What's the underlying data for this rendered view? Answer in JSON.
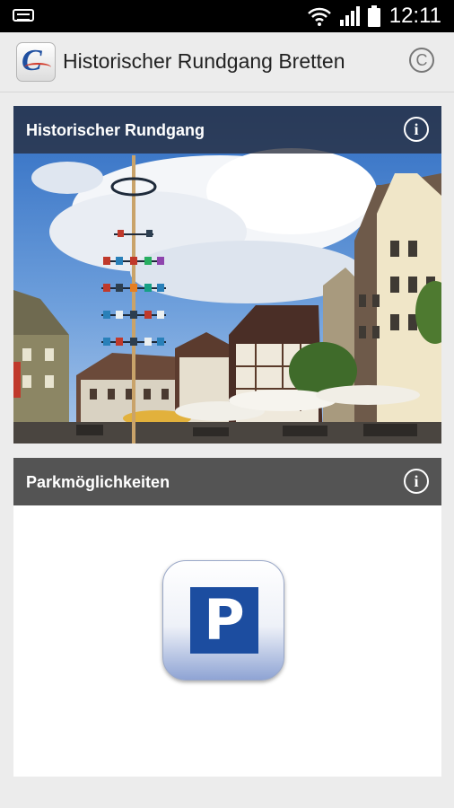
{
  "status_bar": {
    "time": "12:11",
    "icons": [
      "voicemail-icon",
      "wifi-icon",
      "signal-icon",
      "battery-icon"
    ]
  },
  "app_bar": {
    "title": "Historischer Rundgang Bretten",
    "logo_icon": "app-logo-icon",
    "action_icon": "copyright-icon",
    "copyright_symbol": "C"
  },
  "cards": [
    {
      "title": "Historischer Rundgang",
      "info_icon": "info-icon",
      "info_symbol": "i",
      "image": "town-square-maypole-photo"
    },
    {
      "title": "Parkmöglichkeiten",
      "info_icon": "info-icon",
      "info_symbol": "i",
      "image": "parking-icon",
      "parking_letter": "P"
    }
  ],
  "colors": {
    "app_background": "#ececec",
    "card1_header": "#282d3c",
    "card2_header": "#545454",
    "parking_blue": "#1c4da0"
  }
}
